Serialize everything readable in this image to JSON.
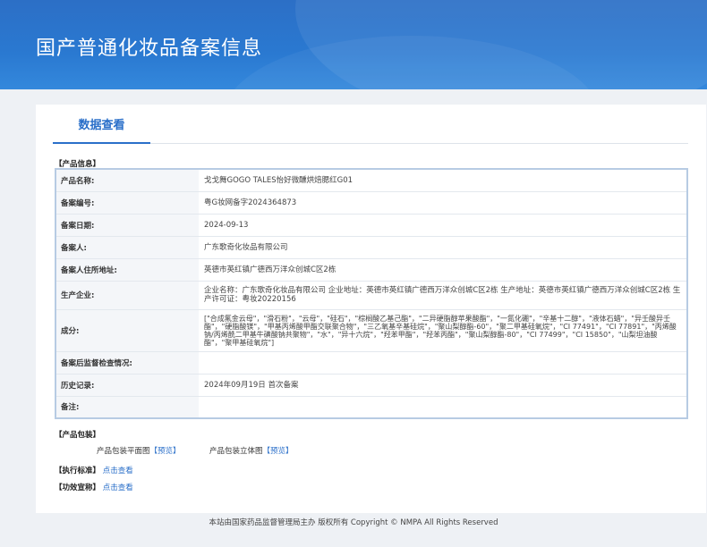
{
  "header": {
    "title": "国产普通化妆品备案信息"
  },
  "tabs": [
    {
      "label": "数据查看"
    }
  ],
  "product_info": {
    "section_label": "【产品信息】",
    "rows": [
      {
        "label": "产品名称:",
        "value": "戈戈舞GOGO TALES怡好微醺烘焙腮红G01"
      },
      {
        "label": "备案编号:",
        "value": "粤G妆网备字2024364873"
      },
      {
        "label": "备案日期:",
        "value": "2024-09-13"
      },
      {
        "label": "备案人:",
        "value": "广东歌奇化妆品有限公司"
      },
      {
        "label": "备案人住所地址:",
        "value": "英德市英红镇广德西万洋众创城C区2栋"
      },
      {
        "label": "生产企业:",
        "value": "企业名称：广东歌奇化妆品有限公司 企业地址：英德市英红镇广德西万洋众创城C区2栋 生产地址：英德市英红镇广德西万洋众创城C区2栋 生产许可证：粤妆20220156"
      },
      {
        "label": "成分:",
        "value": "[\"合成氟金云母\"，\"滑石粉\"，\"云母\"，\"硅石\"，\"棕榈酸乙基己酯\"，\"二异硬脂醇苹果酸酯\"，\"一氮化硼\"，\"辛基十二醇\"，\"液体石蜡\"，\"异壬酸异壬酯\"，\"硬脂酸镁\"，\"甲基丙烯酸甲酯交联聚合物\"，\"三乙氧基辛基硅烷\"，\"聚山梨醇酯-60\"，\"聚二甲基硅氧烷\"，\"CI 77491\"，\"CI 77891\"，\"丙烯酸钠/丙烯酰二甲基牛磺酸钠共聚物\"，\"水\"，\"异十六烷\"，\"羟苯甲酯\"，\"羟苯丙酯\"，\"聚山梨醇酯-80\"，\"CI 77499\"，\"CI 15850\"，\"山梨坦油酸酯\"，\"聚甲基硅氧烷\"]"
      },
      {
        "label": "备案后监督检查情况:",
        "value": ""
      },
      {
        "label": "历史记录:",
        "value": "2024年09月19日 首次备案"
      },
      {
        "label": "备注:",
        "value": ""
      }
    ]
  },
  "packaging": {
    "section_label": "【产品包装】",
    "flat_label": "产品包装平面图",
    "flat_link": "【预览】",
    "solid_label": "产品包装立体图",
    "solid_link": "【预览】"
  },
  "standard": {
    "label": "【执行标准】",
    "link": "点击查看"
  },
  "efficacy": {
    "label": "【功效宣称】",
    "link": "点击查看"
  },
  "footer": {
    "text": "本站由国家药品监督管理局主办 版权所有 Copyright © NMPA All Rights Reserved"
  }
}
